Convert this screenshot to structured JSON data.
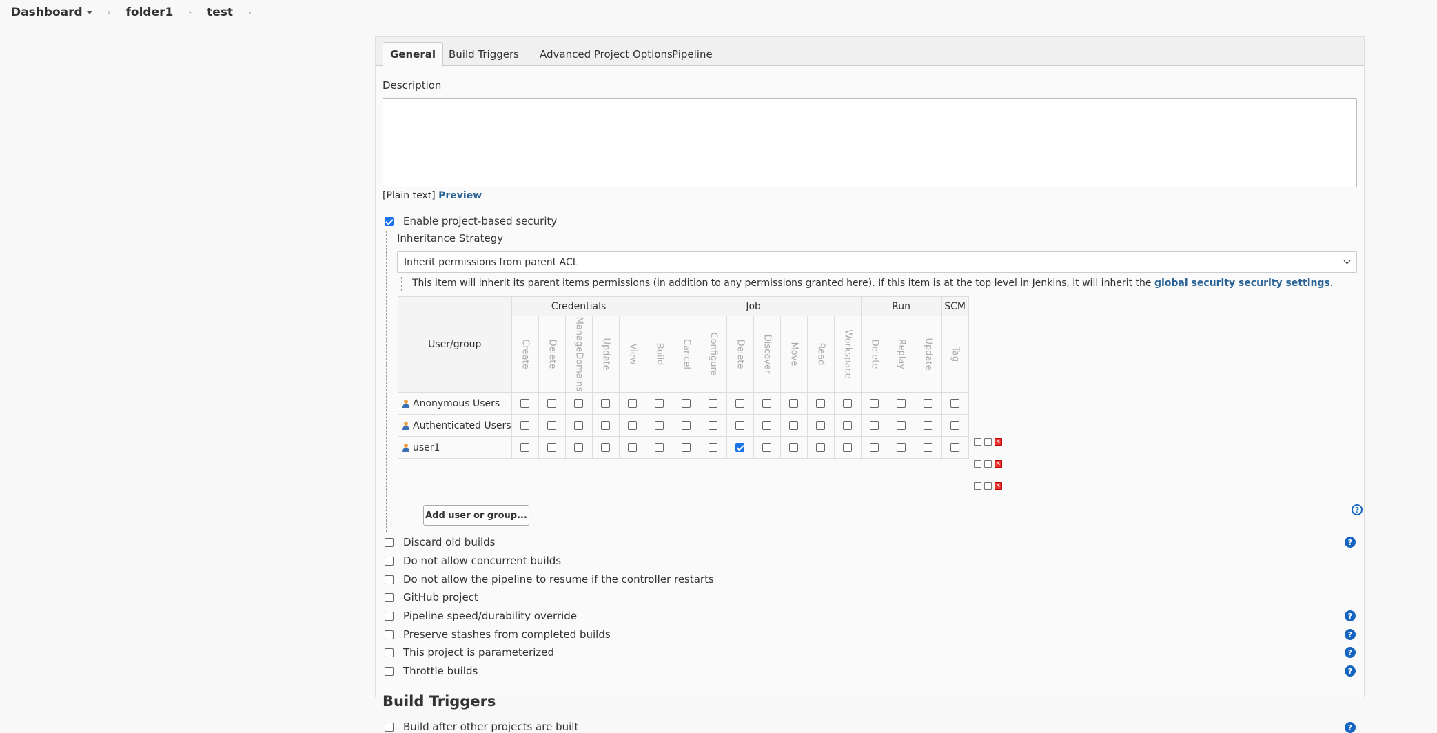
{
  "breadcrumb": {
    "items": [
      "Dashboard",
      "folder1",
      "test"
    ]
  },
  "tabs": [
    "General",
    "Build Triggers",
    "Advanced Project Options",
    "Pipeline"
  ],
  "description": {
    "label": "Description",
    "value": "",
    "format": "[Plain text]",
    "preview": "Preview"
  },
  "security": {
    "enable_label": "Enable project-based security",
    "enabled": true,
    "inheritance_label": "Inheritance Strategy",
    "inheritance_value": "Inherit permissions from parent ACL",
    "note_prefix": "This item will inherit its parent items permissions (in addition to any permissions granted here). If this item is at the top level in Jenkins, it will inherit the",
    "note_link": "global security security settings",
    "note_suffix": "."
  },
  "matrix": {
    "user_group_header": "User/group",
    "groups": [
      "Credentials",
      "Job",
      "Run",
      "SCM"
    ],
    "permissions": [
      "Create",
      "Delete",
      "ManageDomains",
      "Update",
      "View",
      "Build",
      "Cancel",
      "Configure",
      "Delete",
      "Discover",
      "Move",
      "Read",
      "Workspace",
      "Delete",
      "Replay",
      "Update",
      "Tag"
    ],
    "rows": [
      {
        "name": "Anonymous Users",
        "checked": []
      },
      {
        "name": "Authenticated Users",
        "checked": []
      },
      {
        "name": "user1",
        "checked": [
          8
        ]
      }
    ],
    "add_button": "Add user or group..."
  },
  "options": [
    {
      "label": "Discard old builds",
      "checked": false
    },
    {
      "label": "Do not allow concurrent builds",
      "checked": false
    },
    {
      "label": "Do not allow the pipeline to resume if the controller restarts",
      "checked": false
    },
    {
      "label": "GitHub project",
      "checked": false
    },
    {
      "label": "Pipeline speed/durability override",
      "checked": false
    },
    {
      "label": "Preserve stashes from completed builds",
      "checked": false
    },
    {
      "label": "This project is parameterized",
      "checked": false
    },
    {
      "label": "Throttle builds",
      "checked": false
    }
  ],
  "build_triggers": {
    "heading": "Build Triggers",
    "first_option": "Build after other projects are built"
  },
  "help_glyph": "?"
}
